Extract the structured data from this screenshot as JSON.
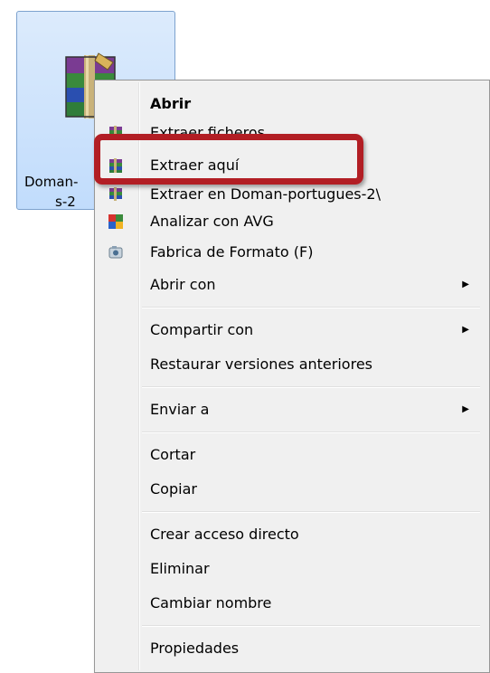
{
  "file": {
    "name_line1": "Doman-",
    "name_line2": "s-2",
    "icon": "winrar-archive-icon"
  },
  "menu": {
    "items": [
      {
        "label": "Abrir",
        "bold": true,
        "icon": null
      },
      {
        "label": "Extraer ficheros...",
        "icon": "winrar-icon"
      },
      {
        "label": "Extraer aquí",
        "icon": "winrar-icon"
      },
      {
        "label": "Extraer en Doman-portugues-2\\",
        "icon": "winrar-icon"
      },
      {
        "label": "Analizar con AVG",
        "icon": "avg-icon"
      },
      {
        "label": "Fabrica de Formato (F)",
        "icon": "format-factory-icon"
      },
      {
        "label": "Abrir con",
        "submenu": true
      },
      {
        "label": "Compartir con",
        "submenu": true
      },
      {
        "label": "Restaurar versiones anteriores"
      },
      {
        "label": "Enviar a",
        "submenu": true
      },
      {
        "label": "Cortar"
      },
      {
        "label": "Copiar"
      },
      {
        "label": "Crear acceso directo"
      },
      {
        "label": "Eliminar"
      },
      {
        "label": "Cambiar nombre"
      },
      {
        "label": "Propiedades"
      }
    ],
    "submenu_arrow": "▶"
  },
  "colors": {
    "highlight": "#b21e24",
    "selection_bg": "#c1dcfc",
    "menu_bg": "#f0f0f0"
  }
}
